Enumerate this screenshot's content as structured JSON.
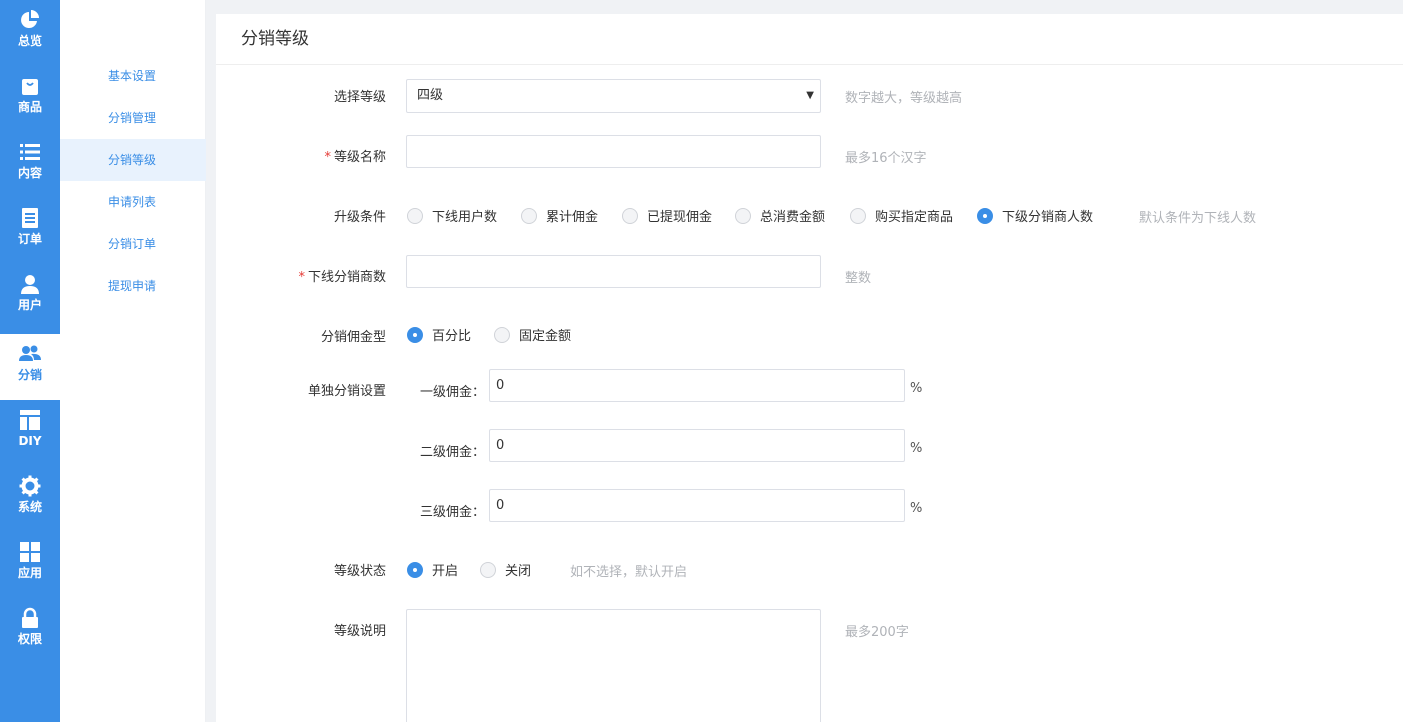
{
  "nav": [
    {
      "label": "总览",
      "icon": "pie-chart-icon"
    },
    {
      "label": "商品",
      "icon": "bag-icon"
    },
    {
      "label": "内容",
      "icon": "list-icon"
    },
    {
      "label": "订单",
      "icon": "document-icon"
    },
    {
      "label": "用户",
      "icon": "user-icon"
    },
    {
      "label": "分销",
      "icon": "users-icon",
      "active": true
    },
    {
      "label": "DIY",
      "icon": "layout-icon"
    },
    {
      "label": "系统",
      "icon": "gear-icon"
    },
    {
      "label": "应用",
      "icon": "grid-icon"
    },
    {
      "label": "权限",
      "icon": "lock-icon"
    }
  ],
  "submenu": [
    {
      "label": "基本设置"
    },
    {
      "label": "分销管理"
    },
    {
      "label": "分销等级",
      "active": true
    },
    {
      "label": "申请列表"
    },
    {
      "label": "分销订单"
    },
    {
      "label": "提现申请"
    }
  ],
  "page": {
    "title": "分销等级"
  },
  "form": {
    "level": {
      "label": "选择等级",
      "value": "四级",
      "hint": "数字越大，等级越高"
    },
    "name": {
      "label": "等级名称",
      "value": "",
      "hint": "最多16个汉字"
    },
    "upgrade": {
      "label": "升级条件",
      "options": [
        "下线用户数",
        "累计佣金",
        "已提现佣金",
        "总消费金额",
        "购买指定商品",
        "下级分销商人数"
      ],
      "selected": 5,
      "hint": "默认条件为下线人数"
    },
    "sub_count": {
      "label": "下线分销商数",
      "value": "",
      "hint": "整数"
    },
    "commission_type": {
      "label": "分销佣金型",
      "options": [
        "百分比",
        "固定金额"
      ],
      "selected": 0
    },
    "single": {
      "label": "单独分销设置",
      "rows": [
        {
          "label": "一级佣金：",
          "value": "0",
          "unit": "%"
        },
        {
          "label": "二级佣金：",
          "value": "0",
          "unit": "%"
        },
        {
          "label": "三级佣金：",
          "value": "0",
          "unit": "%"
        }
      ]
    },
    "status": {
      "label": "等级状态",
      "options": [
        "开启",
        "关闭"
      ],
      "selected": 0,
      "hint": "如不选择，默认开启"
    },
    "desc": {
      "label": "等级说明",
      "value": "",
      "hint": "最多200字"
    }
  },
  "colors": {
    "primary": "#3a8ee6",
    "hint": "#b0b3b8",
    "required": "#e53935"
  }
}
